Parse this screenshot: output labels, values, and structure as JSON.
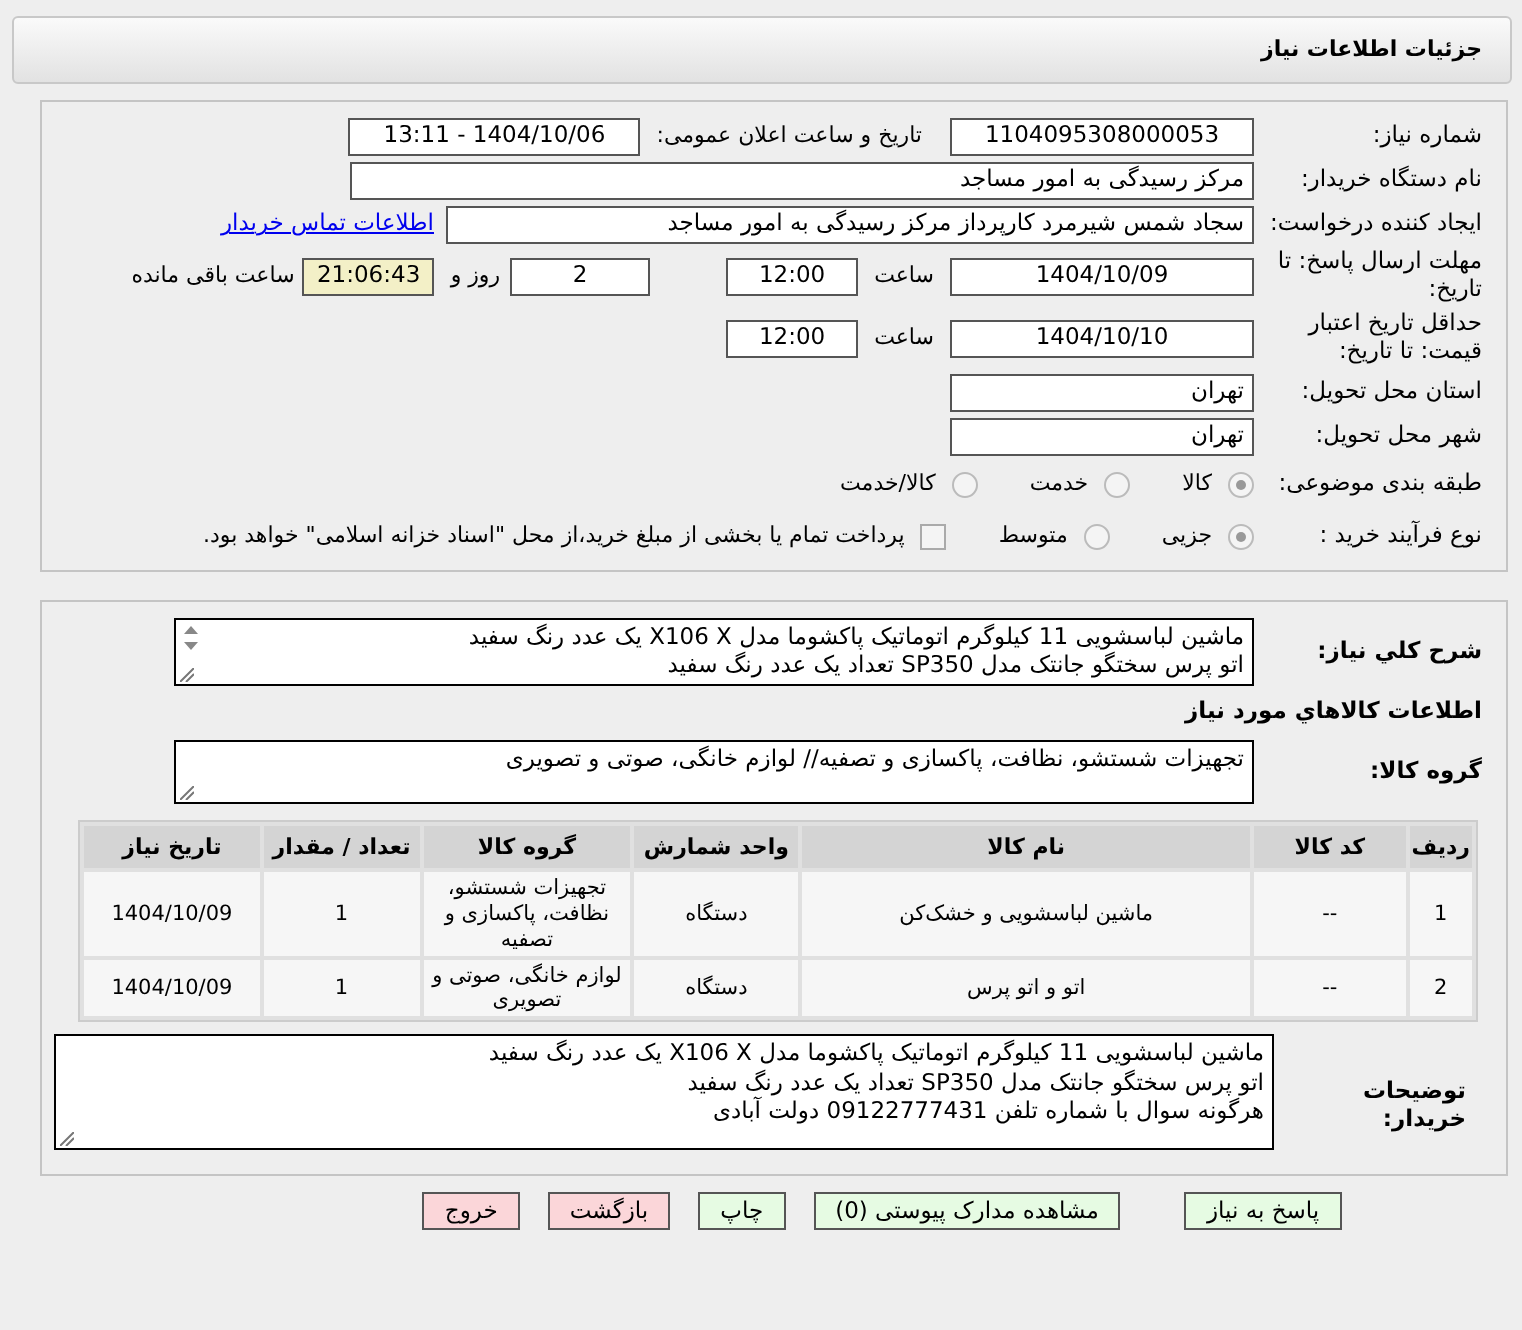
{
  "header": {
    "title": "جزئیات اطلاعات نیاز"
  },
  "need_number": {
    "label": "شماره نیاز:",
    "value": "1104095308000053"
  },
  "announce": {
    "label": "تاریخ و ساعت اعلان عمومی:",
    "value": "1404/10/06 - 13:11"
  },
  "buyer": {
    "label": "نام دستگاه خریدار:",
    "value": "مرکز رسیدگی به امور مساجد"
  },
  "requester": {
    "label": "ایجاد کننده درخواست:",
    "value": "سجاد شمس شیرمرد کارپرداز مرکز رسیدگی به امور مساجد",
    "link": "اطلاعات تماس خریدار"
  },
  "deadline": {
    "label": "مهلت ارسال پاسخ: تا تاریخ:",
    "date": "1404/10/09",
    "time_label": "ساعت",
    "time": "12:00",
    "days": "2",
    "days_label": "روز و",
    "remaining": "21:06:43",
    "remaining_label": "ساعت باقی مانده"
  },
  "validity": {
    "label": "حداقل تاریخ اعتبار قیمت: تا تاریخ:",
    "date": "1404/10/10",
    "time_label": "ساعت",
    "time": "12:00"
  },
  "province": {
    "label": "استان محل تحویل:",
    "value": "تهران"
  },
  "city": {
    "label": "شهر محل تحویل:",
    "value": "تهران"
  },
  "category": {
    "label": "طبقه بندی موضوعی:",
    "options": [
      {
        "label": "کالا",
        "selected": true
      },
      {
        "label": "خدمت",
        "selected": false
      },
      {
        "label": "کالا/خدمت",
        "selected": false
      }
    ]
  },
  "purchase_type": {
    "label": "نوع فرآیند خرید :",
    "options": [
      {
        "label": "جزیی",
        "selected": true
      },
      {
        "label": "متوسط",
        "selected": false
      }
    ],
    "payment": {
      "checked": false,
      "text": "پرداخت تمام یا بخشی از مبلغ خرید،از محل \"اسناد خزانه اسلامی\" خواهد بود."
    }
  },
  "description": {
    "label": "شرح کلي نياز:",
    "lines": [
      "ماشین لباسشویی 11 کیلوگرم اتوماتیک پاکشوما مدل X106 X یک عدد رنگ سفید",
      "اتو پرس سختگو جانتک مدل SP350 تعداد یک عدد رنگ سفید"
    ]
  },
  "goods_title": "اطلاعات کالاهاي مورد نياز",
  "goods_group": {
    "label": "گروه کالا:",
    "value": "تجهیزات شستشو، نظافت، پاکسازی و تصفیه// لوازم خانگی، صوتی و تصویری"
  },
  "table": {
    "columns": [
      "ردیف",
      "کد کالا",
      "نام کالا",
      "واحد شمارش",
      "گروه کالا",
      "تعداد / مقدار",
      "تاریخ نیاز"
    ],
    "rows": [
      [
        "1",
        "--",
        "ماشین لباسشویی و خشک‌کن",
        "دستگاه",
        "تجهیزات شستشو، نظافت، پاکسازی و تصفیه",
        "1",
        "1404/10/09"
      ],
      [
        "2",
        "--",
        "اتو و اتو پرس",
        "دستگاه",
        "لوازم خانگی، صوتی و تصویری",
        "1",
        "1404/10/09"
      ]
    ]
  },
  "buyer_notes": {
    "label": "توضیحات خریدار:",
    "lines": [
      "ماشین لباسشویی 11 کیلوگرم اتوماتیک پاکشوما مدل X106 X یک عدد رنگ سفید",
      "اتو پرس سختگو جانتک مدل SP350 تعداد یک عدد رنگ سفید",
      "هرگونه سوال با شماره تلفن 09122777431 دولت آبادی"
    ]
  },
  "buttons": [
    {
      "label": "پاسخ به نیاز",
      "kind": "action"
    },
    {
      "label": "مشاهده مدارک پیوستی (0)",
      "kind": "action"
    },
    {
      "label": "چاپ",
      "kind": "action"
    },
    {
      "label": "بازگشت",
      "kind": "exit"
    },
    {
      "label": "خروج",
      "kind": "exit"
    }
  ]
}
